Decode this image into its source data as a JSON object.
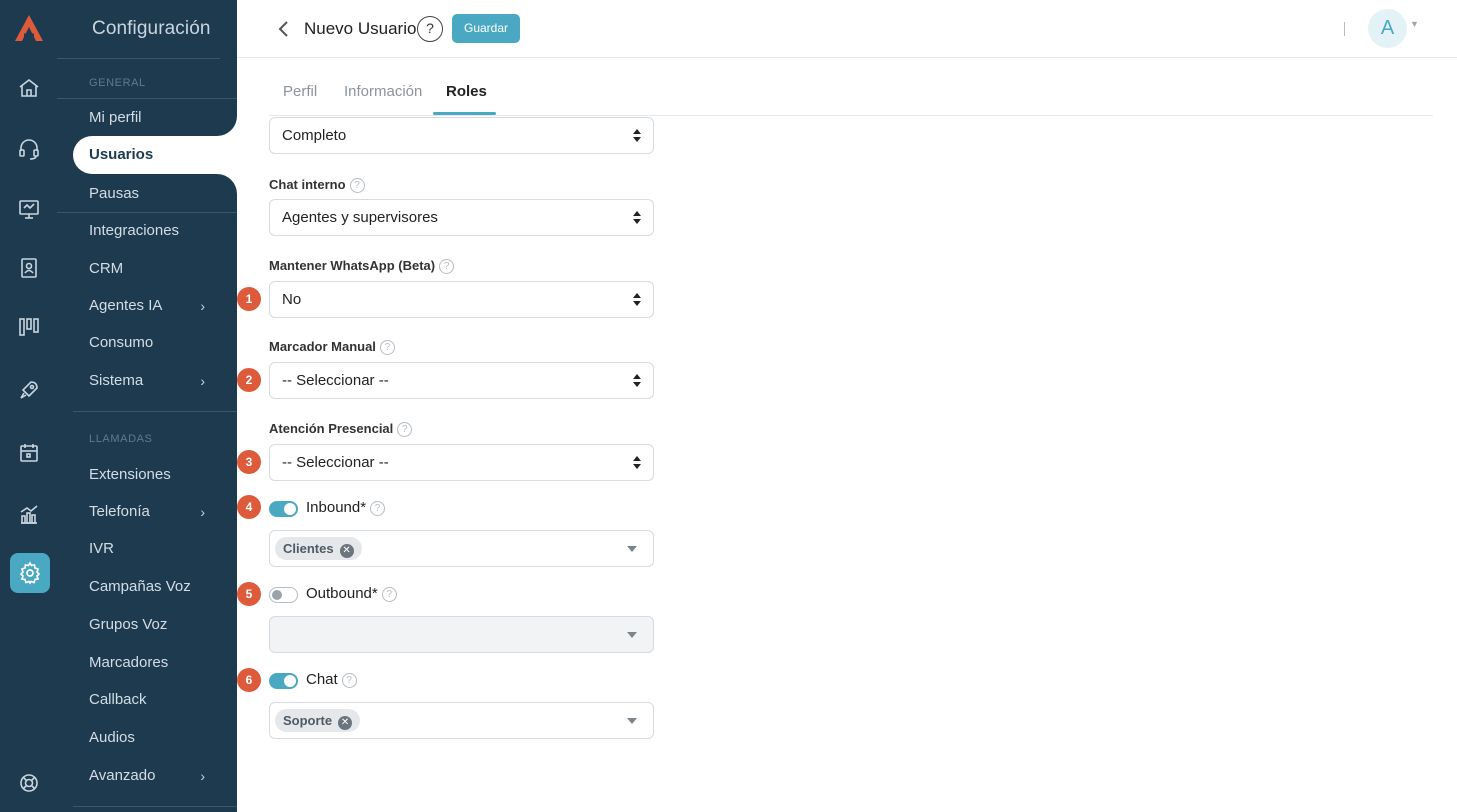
{
  "app": {
    "section_title": "Configuración"
  },
  "rail": {
    "icons": [
      "logo-icon",
      "home-icon",
      "headset-icon",
      "monitor-icon",
      "contact-book-icon",
      "kanban-icon",
      "rocket-icon",
      "calendar-icon",
      "chart-icon",
      "settings-icon",
      "support-icon"
    ],
    "active": "settings-icon",
    "accent_color": "#4aa8c2"
  },
  "menu": {
    "sections": {
      "general": "GENERAL",
      "calls": "LLAMADAS"
    },
    "general_items": [
      "Mi perfil",
      "Usuarios",
      "Pausas",
      "Integraciones",
      "CRM",
      "Agentes IA",
      "Consumo",
      "Sistema"
    ],
    "calls_items": [
      "Extensiones",
      "Telefonía",
      "IVR",
      "Campañas Voz",
      "Grupos Voz",
      "Marcadores",
      "Callback",
      "Audios",
      "Avanzado"
    ],
    "active_item": "Usuarios",
    "background_color": "#1e3a4f"
  },
  "header": {
    "title": "Nuevo Usuario",
    "help": "?",
    "save_label": "Guardar",
    "avatar_initial": "A"
  },
  "tabs": {
    "items": [
      "Perfil",
      "Información",
      "Roles"
    ],
    "active": "Roles"
  },
  "form": {
    "top_select": {
      "value": "Completo"
    },
    "chat_interno": {
      "label": "Chat interno",
      "value": "Agentes y supervisores"
    },
    "whatsapp": {
      "label": "Mantener WhatsApp (Beta)",
      "value": "No",
      "badge": "1"
    },
    "marcador": {
      "label": "Marcador Manual",
      "value": "-- Seleccionar --",
      "badge": "2"
    },
    "atencion": {
      "label": "Atención Presencial",
      "value": "-- Seleccionar --",
      "badge": "3"
    },
    "inbound": {
      "label": "Inbound*",
      "enabled": true,
      "badge": "4",
      "chips": [
        "Clientes"
      ]
    },
    "outbound": {
      "label": "Outbound*",
      "enabled": false,
      "badge": "5",
      "chips": []
    },
    "chat": {
      "label": "Chat",
      "enabled": true,
      "badge": "6",
      "chips": [
        "Soporte"
      ]
    },
    "badge_color": "#dd5a3b"
  }
}
